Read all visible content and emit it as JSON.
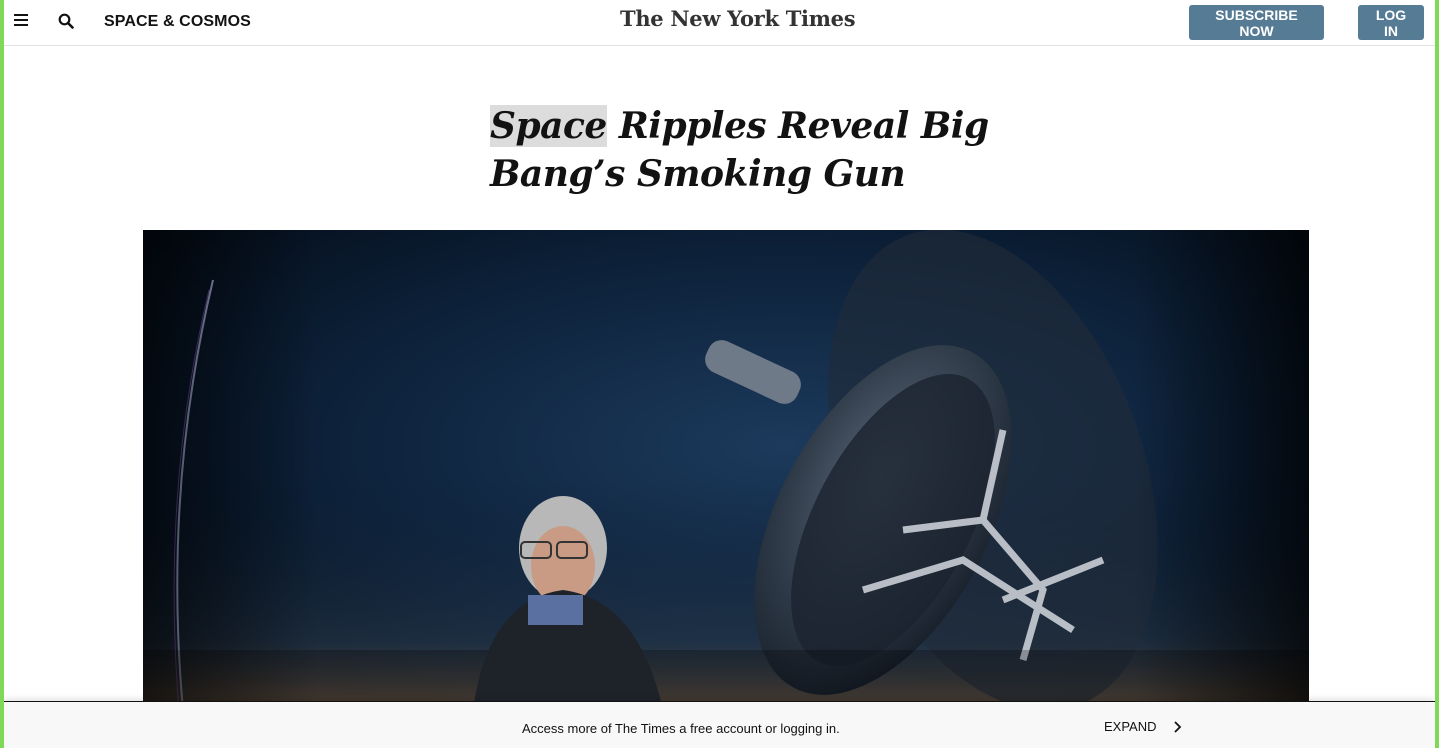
{
  "header": {
    "menu_icon": "hamburger-menu-icon",
    "search_icon": "search-icon",
    "section_label": "SPACE & COSMOS",
    "logo_text": "The New York Times",
    "subscribe_label": "SUBSCRIBE NOW",
    "login_label": "LOG IN",
    "button_color": "#567b95"
  },
  "article": {
    "headline_highlight": "Space",
    "headline_rest": " Ripples Reveal Big Bang’s Smoking Gun"
  },
  "footer": {
    "message": "Access more of The Times a free account or logging in.",
    "expand_label": "EXPAND",
    "expand_icon": "chevron-right-icon"
  },
  "colors": {
    "page_border": "#7ed957",
    "highlight": "#dcdcdc"
  }
}
